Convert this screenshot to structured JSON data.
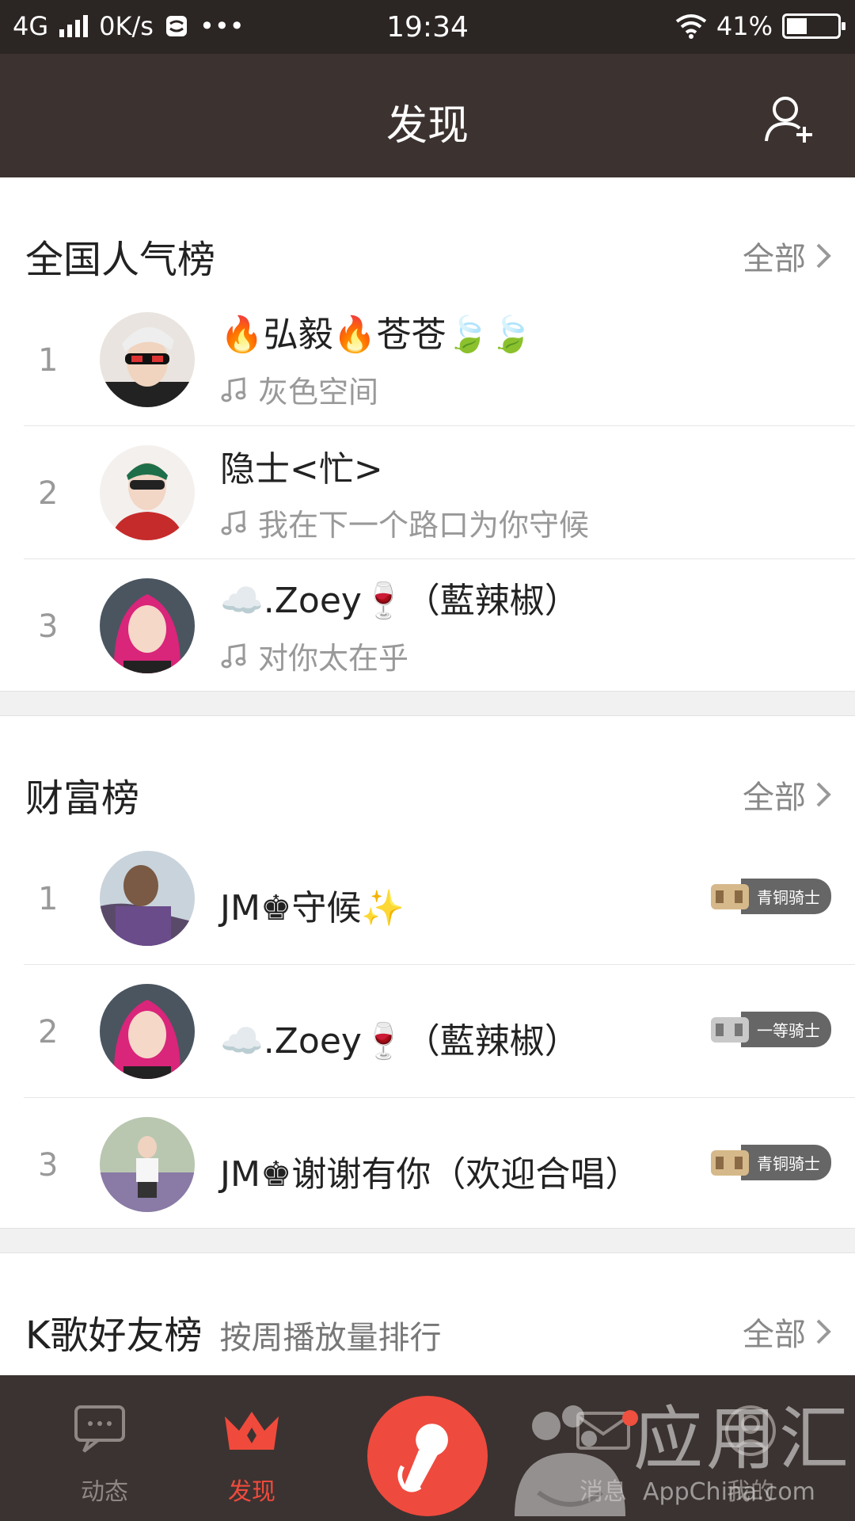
{
  "status_bar": {
    "network": "4G",
    "speed": "0K/s",
    "more": "•••",
    "time": "19:34",
    "battery": "41%",
    "battery_level": 0.41
  },
  "header": {
    "title": "发现",
    "add_friend_icon": "add-user-icon"
  },
  "popularity": {
    "title": "全国人气榜",
    "all_label": "全部",
    "items": [
      {
        "rank": "1",
        "name": "🔥弘毅🔥苍苍🍃🍃",
        "song": "灰色空间"
      },
      {
        "rank": "2",
        "name": "隐士<忙>",
        "song": "我在下一个路口为你守候"
      },
      {
        "rank": "3",
        "name": "☁️.Zoey🍷（藍辣椒）",
        "song": "对你太在乎"
      }
    ]
  },
  "wealth": {
    "title": "财富榜",
    "all_label": "全部",
    "items": [
      {
        "rank": "1",
        "name": "JM♚守候✨",
        "badge": "青铜骑士"
      },
      {
        "rank": "2",
        "name": "☁️.Zoey🍷（藍辣椒）",
        "badge": "一等骑士"
      },
      {
        "rank": "3",
        "name": "JM♚谢谢有你（欢迎合唱）",
        "badge": "青铜骑士"
      }
    ]
  },
  "friends": {
    "title": "K歌好友榜",
    "subtitle": "按周播放量排行",
    "all_label": "全部"
  },
  "bottom_nav": {
    "items": [
      {
        "label": "动态",
        "icon": "chat-bubble-icon"
      },
      {
        "label": "发现",
        "icon": "crown-icon"
      },
      {
        "label": "消息",
        "icon": "envelope-icon"
      },
      {
        "label": "我的",
        "icon": "profile-icon"
      }
    ],
    "record_icon": "microphone-icon"
  },
  "watermark": {
    "text": "应用汇",
    "sub": "AppChina.com"
  },
  "colors": {
    "statusbar": "#2b2523",
    "header": "#3c3331",
    "accent": "#f04a3c",
    "nav": "#3b3331"
  }
}
